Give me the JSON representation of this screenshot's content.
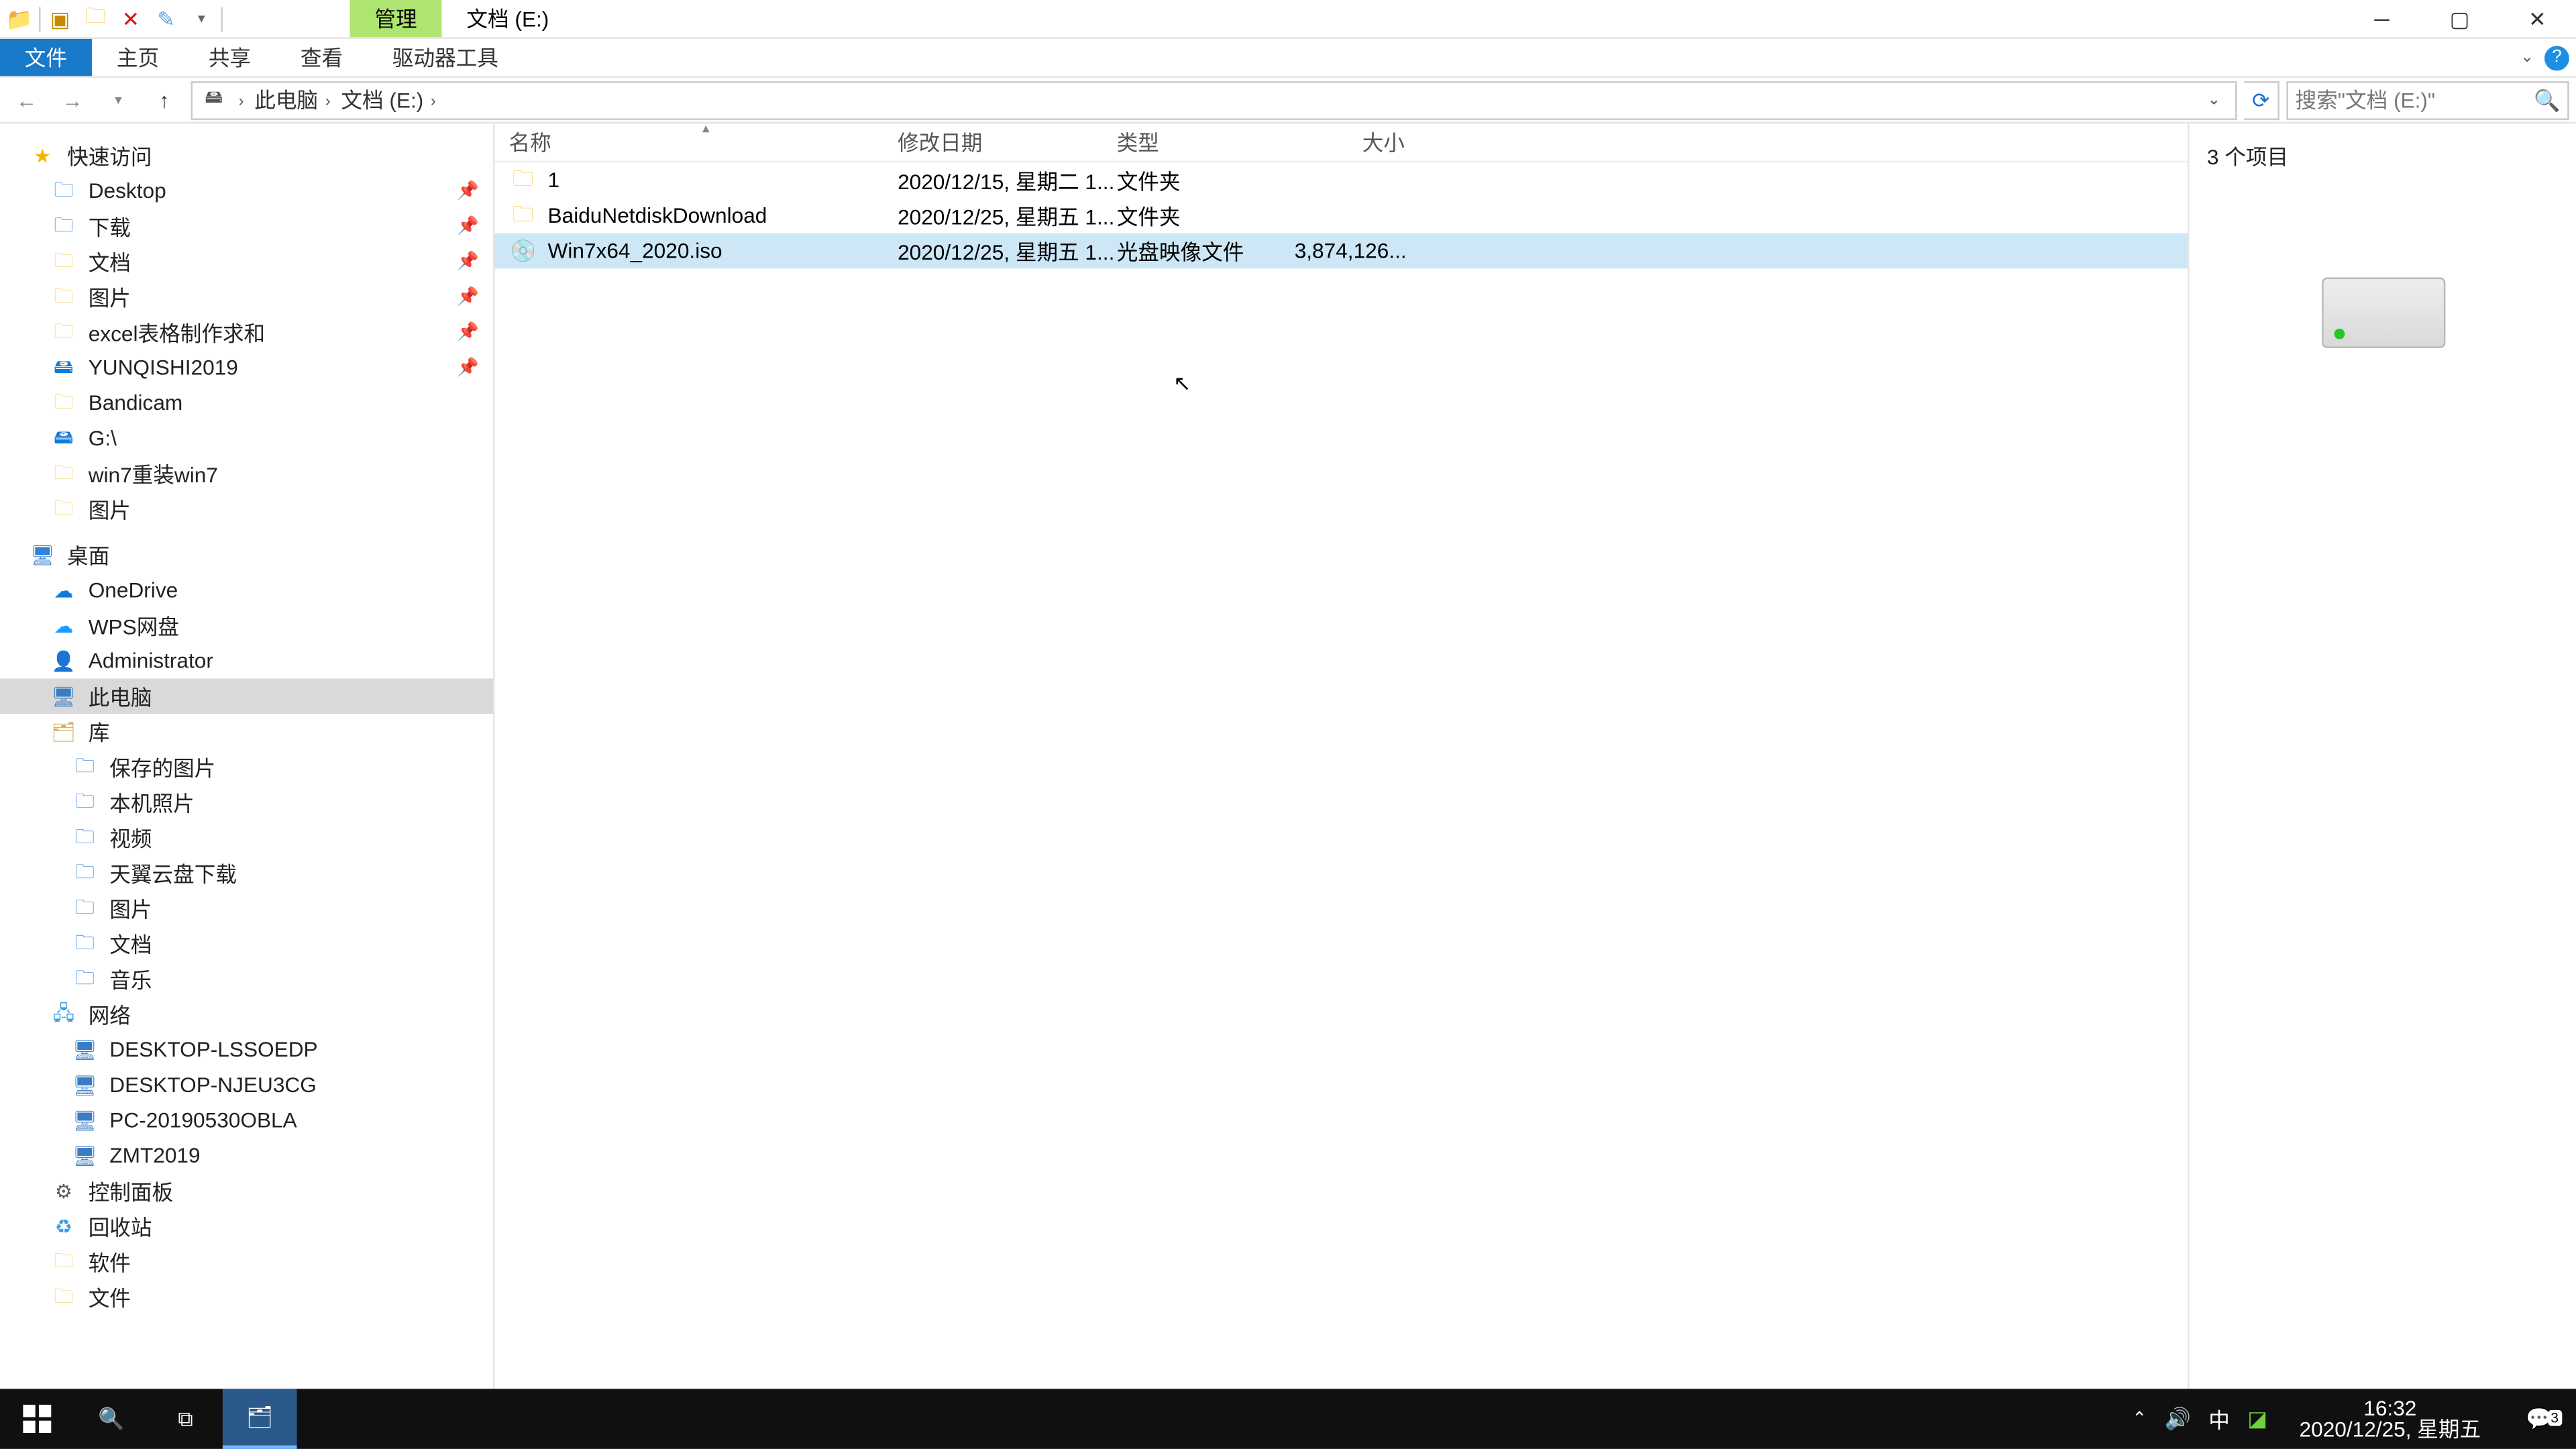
{
  "titlebar": {
    "context_tab": "管理",
    "title": "文档 (E:)"
  },
  "ribbon": {
    "file": "文件",
    "tabs": [
      "主页",
      "共享",
      "查看",
      "驱动器工具"
    ]
  },
  "address": {
    "segs": [
      "此电脑",
      "文档 (E:)"
    ],
    "search_placeholder": "搜索\"文档 (E:)\""
  },
  "nav": {
    "quick": "快速访问",
    "quick_items": [
      {
        "label": "Desktop",
        "icon": "blue",
        "pin": true
      },
      {
        "label": "下载",
        "icon": "blue",
        "pin": true
      },
      {
        "label": "文档",
        "icon": "folder",
        "pin": true
      },
      {
        "label": "图片",
        "icon": "folder",
        "pin": true
      },
      {
        "label": "excel表格制作求和",
        "icon": "folder",
        "pin": true
      },
      {
        "label": "YUNQISHI2019",
        "icon": "gdrive",
        "pin": true
      },
      {
        "label": "Bandicam",
        "icon": "folder"
      },
      {
        "label": "G:\\",
        "icon": "gdrive"
      },
      {
        "label": "win7重装win7",
        "icon": "folder"
      },
      {
        "label": "图片",
        "icon": "folder"
      }
    ],
    "desktop": "桌面",
    "desktop_items": [
      {
        "label": "OneDrive",
        "icon": "cloud"
      },
      {
        "label": "WPS网盘",
        "icon": "wps"
      },
      {
        "label": "Administrator",
        "icon": "user"
      },
      {
        "label": "此电脑",
        "icon": "pc",
        "sel": true
      },
      {
        "label": "库",
        "icon": "lib"
      }
    ],
    "lib_items": [
      {
        "label": "保存的图片",
        "icon": "blue"
      },
      {
        "label": "本机照片",
        "icon": "blue"
      },
      {
        "label": "视频",
        "icon": "blue"
      },
      {
        "label": "天翼云盘下载",
        "icon": "blue"
      },
      {
        "label": "图片",
        "icon": "blue"
      },
      {
        "label": "文档",
        "icon": "blue"
      },
      {
        "label": "音乐",
        "icon": "blue"
      }
    ],
    "net": "网络",
    "net_items": [
      {
        "label": "DESKTOP-LSSOEDP",
        "icon": "pc"
      },
      {
        "label": "DESKTOP-NJEU3CG",
        "icon": "pc"
      },
      {
        "label": "PC-20190530OBLA",
        "icon": "pc"
      },
      {
        "label": "ZMT2019",
        "icon": "pc"
      }
    ],
    "tail": [
      {
        "label": "控制面板",
        "icon": "cpanel"
      },
      {
        "label": "回收站",
        "icon": "recycle"
      },
      {
        "label": "软件",
        "icon": "folder"
      },
      {
        "label": "文件",
        "icon": "folder"
      }
    ]
  },
  "columns": {
    "name": "名称",
    "date": "修改日期",
    "type": "类型",
    "size": "大小"
  },
  "files": [
    {
      "name": "1",
      "date": "2020/12/15, 星期二 1...",
      "type": "文件夹",
      "size": "",
      "icon": "folder"
    },
    {
      "name": "BaiduNetdiskDownload",
      "date": "2020/12/25, 星期五 1...",
      "type": "文件夹",
      "size": "",
      "icon": "folder"
    },
    {
      "name": "Win7x64_2020.iso",
      "date": "2020/12/25, 星期五 1...",
      "type": "光盘映像文件",
      "size": "3,874,126...",
      "icon": "iso",
      "sel": true
    }
  ],
  "preview": {
    "title": "3 个项目"
  },
  "status": {
    "text": "3 个项目"
  },
  "taskbar": {
    "time": "16:32",
    "date": "2020/12/25, 星期五",
    "ime": "中",
    "badge": "3"
  }
}
